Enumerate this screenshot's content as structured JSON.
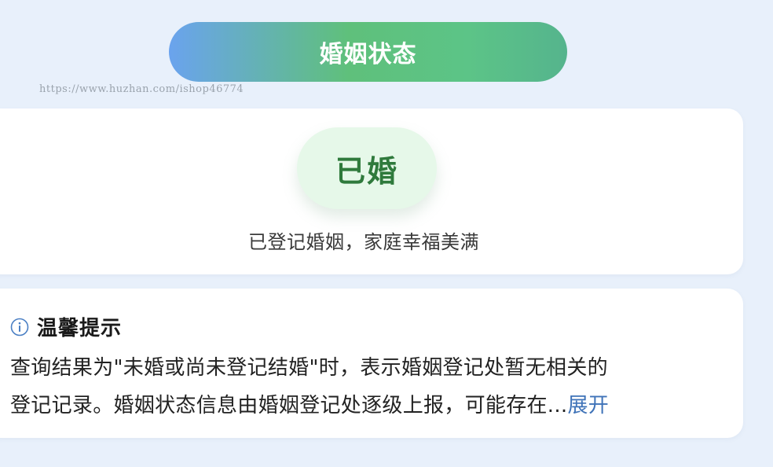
{
  "header": {
    "title": "婚姻状态"
  },
  "watermark": {
    "text": "https://www.huzhan.com/ishop46774"
  },
  "status": {
    "badge": "已婚",
    "description": "已登记婚姻，家庭幸福美满",
    "badge_color": "#2f7a3c",
    "badge_bg": "#e6f8e9"
  },
  "tip": {
    "icon": "info-icon",
    "title": "温馨提示",
    "line1": "查询结果为\"未婚或尚未登记结婚\"时，表示婚姻登记处暂无相关的",
    "line2": "登记记录。婚姻状态信息由婚姻登记处逐级上报，可能存在...",
    "expand_label": "展开",
    "accent_color": "#3f73b8"
  }
}
